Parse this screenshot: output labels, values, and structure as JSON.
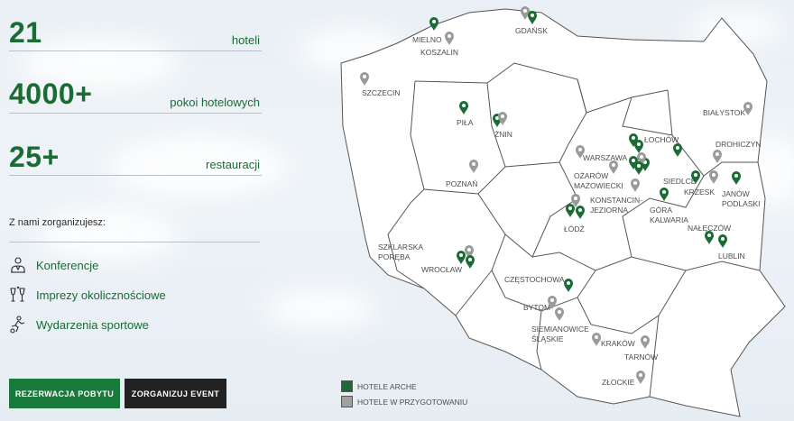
{
  "stats": [
    {
      "value": "21",
      "label": "hoteli"
    },
    {
      "value": "4000+",
      "label": "pokoi hotelowych"
    },
    {
      "value": "25+",
      "label": "restauracji"
    }
  ],
  "organize": {
    "title": "Z nami zorganizujesz:",
    "items": [
      {
        "label": "Konferencje",
        "icon": "presenter-icon"
      },
      {
        "label": "Imprezy okolicznościowe",
        "icon": "champagne-glasses-icon"
      },
      {
        "label": "Wydarzenia sportowe",
        "icon": "soccer-player-icon"
      }
    ]
  },
  "buttons": {
    "reserve": "REZERWACJA POBYTU",
    "event": "ZORGANIZUJ EVENT"
  },
  "legend": {
    "arche": "HOTELE ARCHE",
    "preparing": "HOTELE W PRZYGOTOWANIU"
  },
  "colors": {
    "accent": "#1a6b34",
    "pin_arche": "#1a6b34",
    "pin_preparing": "#9a9a9a",
    "button_green": "#1a7a3c",
    "button_dark": "#222222"
  },
  "map": {
    "cities": [
      {
        "id": "mielno",
        "label": [
          "MIELNO"
        ]
      },
      {
        "id": "koszalin",
        "label": [
          "KOSZALIN"
        ]
      },
      {
        "id": "gdansk",
        "label": [
          "GDAŃSK"
        ]
      },
      {
        "id": "szczecin",
        "label": [
          "SZCZECIN"
        ]
      },
      {
        "id": "pila",
        "label": [
          "PIŁA"
        ]
      },
      {
        "id": "znin",
        "label": [
          "ŻNIN"
        ]
      },
      {
        "id": "bialystok",
        "label": [
          "BIAŁYSTOK"
        ]
      },
      {
        "id": "lochow",
        "label": [
          "ŁOCHÓW"
        ]
      },
      {
        "id": "drohiczyn",
        "label": [
          "DROHICZYN"
        ]
      },
      {
        "id": "warszawa",
        "label": [
          "WARSZAWA"
        ]
      },
      {
        "id": "ozarow",
        "label": [
          "OŻARÓW",
          "MAZOWIECKI"
        ]
      },
      {
        "id": "siedlce",
        "label": [
          "SIEDLCE"
        ]
      },
      {
        "id": "krzesk",
        "label": [
          "KRZESK"
        ]
      },
      {
        "id": "janow",
        "label": [
          "JANÓW",
          "PODLASKI"
        ]
      },
      {
        "id": "poznan",
        "label": [
          "POZNAŃ"
        ]
      },
      {
        "id": "konstancin",
        "label": [
          "KONSTANCIN-",
          "JEZIORNA"
        ]
      },
      {
        "id": "gora",
        "label": [
          "GÓRA",
          "KALWARIA"
        ]
      },
      {
        "id": "lodz",
        "label": [
          "ŁÓDŹ"
        ]
      },
      {
        "id": "naleczow",
        "label": [
          "NAŁĘCZÓW"
        ]
      },
      {
        "id": "lublin",
        "label": [
          "LUBLIN"
        ]
      },
      {
        "id": "szklarska",
        "label": [
          "SZKLARSKA",
          "PORĘBA"
        ]
      },
      {
        "id": "wroclaw",
        "label": [
          "WROCŁAW"
        ]
      },
      {
        "id": "czestochowa",
        "label": [
          "CZĘSTOCHOWA"
        ]
      },
      {
        "id": "bytom",
        "label": [
          "BYTOM"
        ]
      },
      {
        "id": "siemianowice",
        "label": [
          "SIEMIANOWICE",
          "ŚLĄSKIE"
        ]
      },
      {
        "id": "krakow",
        "label": [
          "KRAKÓW"
        ]
      },
      {
        "id": "tarnow",
        "label": [
          "TARNÓW"
        ]
      },
      {
        "id": "zlockie",
        "label": [
          "ZŁOCKIE"
        ]
      }
    ],
    "pins": [
      {
        "status": "arche"
      },
      {
        "status": "preparing"
      },
      {
        "status": "preparing"
      },
      {
        "status": "arche"
      },
      {
        "status": "preparing"
      },
      {
        "status": "arche"
      },
      {
        "status": "arche"
      },
      {
        "status": "preparing"
      },
      {
        "status": "preparing"
      },
      {
        "status": "arche"
      },
      {
        "status": "preparing"
      },
      {
        "status": "arche"
      },
      {
        "status": "preparing"
      },
      {
        "status": "arche"
      },
      {
        "status": "arche"
      },
      {
        "status": "arche"
      },
      {
        "status": "arche"
      },
      {
        "status": "preparing"
      },
      {
        "status": "preparing"
      },
      {
        "status": "arche"
      },
      {
        "status": "preparing"
      },
      {
        "status": "arche"
      },
      {
        "status": "preparing"
      },
      {
        "status": "arche"
      },
      {
        "status": "arche"
      },
      {
        "status": "preparing"
      },
      {
        "status": "arche"
      },
      {
        "status": "arche"
      },
      {
        "status": "arche"
      },
      {
        "status": "preparing"
      },
      {
        "status": "arche"
      },
      {
        "status": "arche"
      },
      {
        "status": "arche"
      },
      {
        "status": "preparing"
      },
      {
        "status": "preparing"
      },
      {
        "status": "preparing"
      },
      {
        "status": "preparing"
      },
      {
        "status": "preparing"
      },
      {
        "status": "preparing"
      }
    ]
  }
}
